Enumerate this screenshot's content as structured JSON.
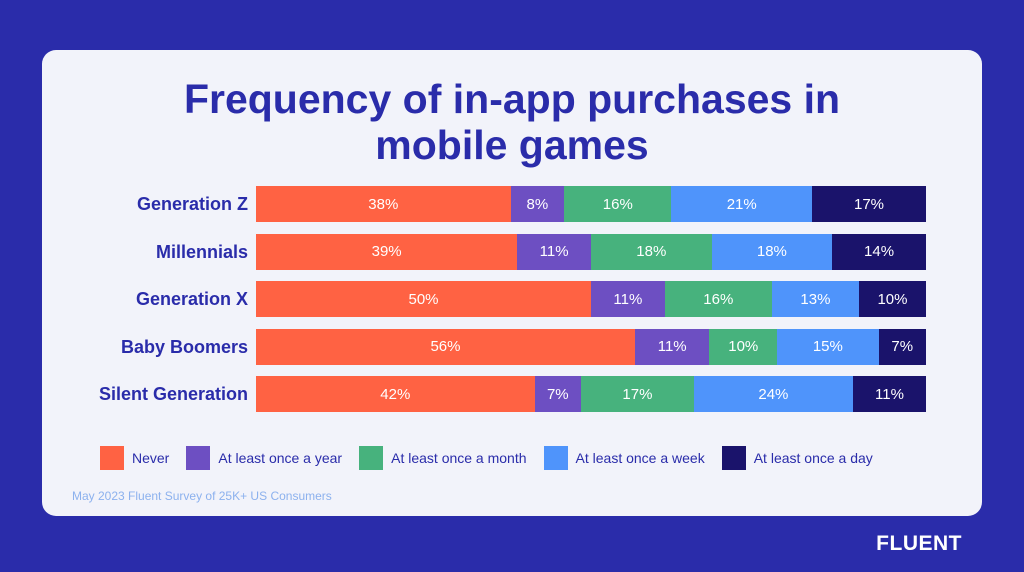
{
  "chart_data": {
    "type": "bar",
    "orientation": "horizontal",
    "stacked": true,
    "title": "Frequency of in-app purchases in mobile games",
    "categories": [
      "Generation Z",
      "Millennials",
      "Generation X",
      "Baby Boomers",
      "Silent Generation"
    ],
    "series": [
      {
        "name": "Never",
        "color": "#ff6243",
        "values": [
          38,
          39,
          50,
          56,
          42
        ]
      },
      {
        "name": "At least once a year",
        "color": "#6d4fc2",
        "values": [
          8,
          11,
          11,
          11,
          7
        ]
      },
      {
        "name": "At least once a month",
        "color": "#47b27d",
        "values": [
          16,
          18,
          16,
          10,
          17
        ]
      },
      {
        "name": "At least once a week",
        "color": "#4f94fb",
        "values": [
          21,
          18,
          13,
          15,
          24
        ]
      },
      {
        "name": "At least once a day",
        "color": "#1a136b",
        "values": [
          17,
          14,
          10,
          7,
          11
        ]
      }
    ],
    "value_format": "{v}%",
    "legend_position": "bottom",
    "grid": false
  },
  "title_lines": [
    "Frequency of in-app purchases in",
    "mobile games"
  ],
  "source": "May 2023 Fluent Survey of 25K+ US Consumers",
  "brand": "FLUENT",
  "colors": {
    "background": "#2a2caa",
    "card": "#f2f3fa",
    "accent": "#2a2caa"
  }
}
